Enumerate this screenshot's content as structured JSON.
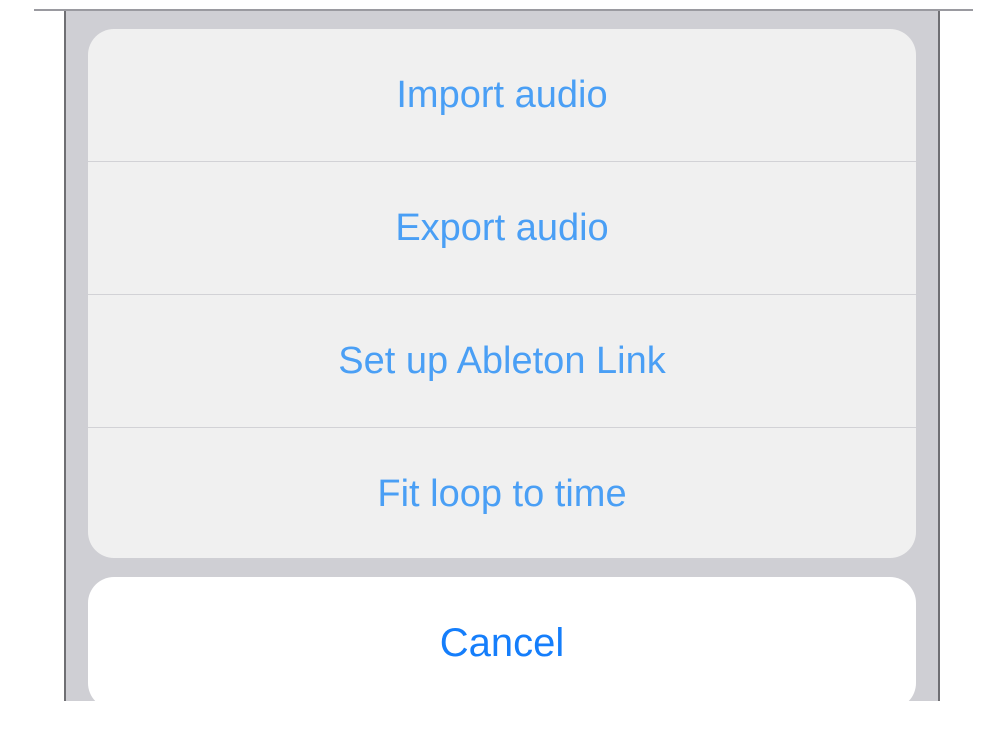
{
  "action_sheet": {
    "items": [
      {
        "label": "Import audio"
      },
      {
        "label": "Export audio"
      },
      {
        "label": "Set up Ableton Link"
      },
      {
        "label": "Fit loop to time"
      }
    ],
    "cancel_label": "Cancel"
  },
  "colors": {
    "action_text": "#4a9ff5",
    "cancel_text": "#157efb",
    "sheet_background": "#f0f0f0",
    "cancel_background": "#ffffff",
    "dim_overlay": "#cfcfd4"
  }
}
